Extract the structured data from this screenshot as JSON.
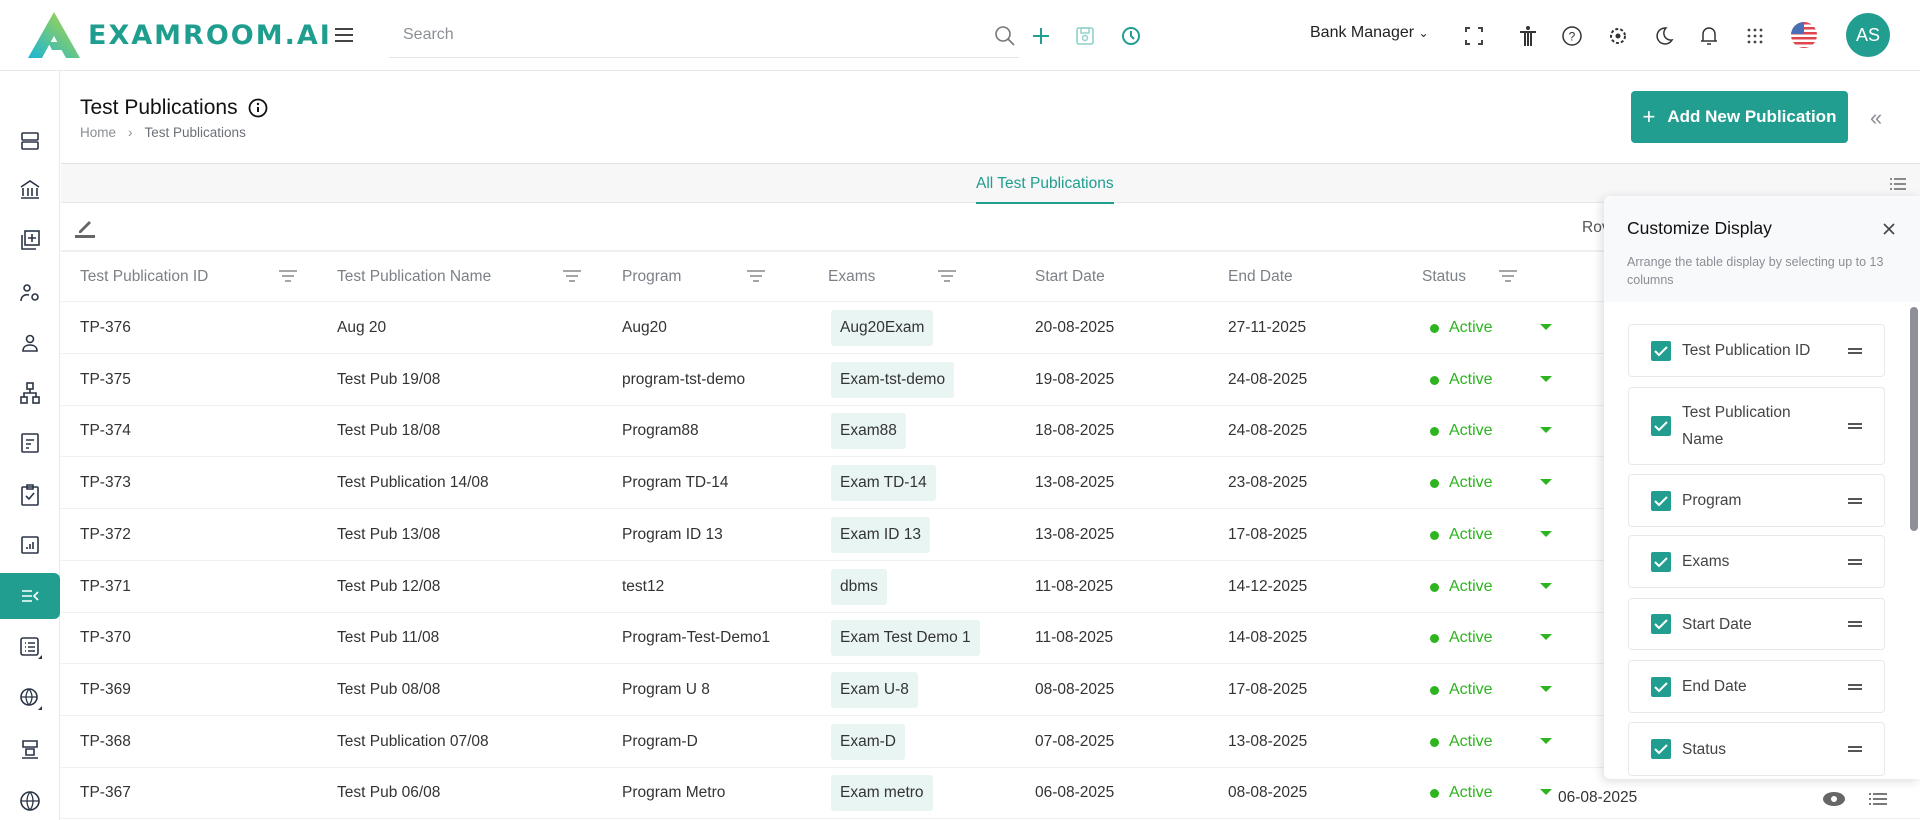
{
  "header": {
    "brand": "EXAMROOM.AI",
    "search_placeholder": "Search",
    "role": "Bank Manager",
    "avatar": "AS"
  },
  "page": {
    "title": "Test Publications",
    "breadcrumb": [
      "Home",
      "Test Publications"
    ],
    "add_button": "Add New Publication",
    "tab": "All Test Publications",
    "rows_label": "Rov"
  },
  "colors": {
    "accent": "#229e90",
    "active": "#2cb51e"
  },
  "table": {
    "columns": [
      "Test Publication ID",
      "Test Publication Name",
      "Program",
      "Exams",
      "Start Date",
      "End Date",
      "Status"
    ],
    "rows": [
      [
        "TP-376",
        "Aug 20",
        "Aug20",
        "Aug20Exam",
        "20-08-2025",
        "27-11-2025",
        "Active"
      ],
      [
        "TP-375",
        "Test Pub 19/08",
        "program-tst-demo",
        "Exam-tst-demo",
        "19-08-2025",
        "24-08-2025",
        "Active"
      ],
      [
        "TP-374",
        "Test Pub 18/08",
        "Program88",
        "Exam88",
        "18-08-2025",
        "24-08-2025",
        "Active"
      ],
      [
        "TP-373",
        "Test Publication 14/08",
        "Program TD-14",
        "Exam TD-14",
        "13-08-2025",
        "23-08-2025",
        "Active"
      ],
      [
        "TP-372",
        "Test Pub 13/08",
        "Program ID 13",
        "Exam ID 13",
        "13-08-2025",
        "17-08-2025",
        "Active"
      ],
      [
        "TP-371",
        "Test Pub 12/08",
        "test12",
        "dbms",
        "11-08-2025",
        "14-12-2025",
        "Active"
      ],
      [
        "TP-370",
        "Test Pub 11/08",
        "Program-Test-Demo1",
        "Exam Test Demo 1",
        "11-08-2025",
        "14-08-2025",
        "Active"
      ],
      [
        "TP-369",
        "Test Pub 08/08",
        "Program U 8",
        "Exam U-8",
        "08-08-2025",
        "17-08-2025",
        "Active"
      ],
      [
        "TP-368",
        "Test Publication 07/08",
        "Program-D",
        "Exam-D",
        "07-08-2025",
        "13-08-2025",
        "Active"
      ],
      [
        "TP-367",
        "Test Pub 06/08",
        "Program Metro",
        "Exam metro",
        "06-08-2025",
        "08-08-2025",
        "Active"
      ]
    ],
    "last_row_extra_date": "06-08-2025"
  },
  "customize": {
    "title": "Customize Display",
    "description": "Arrange the table display by selecting up to 13 columns",
    "items": [
      {
        "label": "Test Publication ID",
        "checked": true
      },
      {
        "label": "Test Publication Name",
        "checked": true
      },
      {
        "label": "Program",
        "checked": true
      },
      {
        "label": "Exams",
        "checked": true
      },
      {
        "label": "Start Date",
        "checked": true
      },
      {
        "label": "End Date",
        "checked": true
      },
      {
        "label": "Status",
        "checked": true
      }
    ]
  }
}
